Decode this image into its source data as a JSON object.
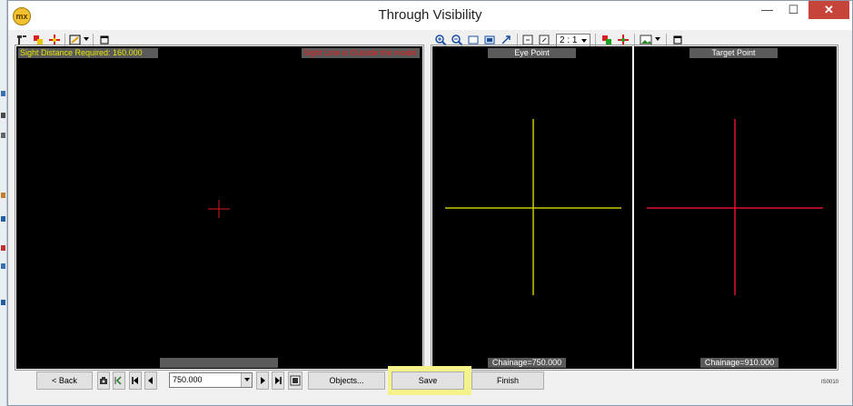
{
  "window": {
    "title": "Through Visibility",
    "app_logo_text": "mx",
    "minimize_glyph": "—",
    "maximize_glyph": "☐",
    "close_glyph": "✕"
  },
  "left_view": {
    "sight_distance_label": "Sight Distance Required: 160.000",
    "sight_line_warning": "Sight Line is Outside the model",
    "bottom_label": ""
  },
  "eye_view": {
    "title": "Eye Point",
    "chainage": "Chainage=750.000"
  },
  "target_view": {
    "title": "Target Point",
    "chainage": "Chainage=910.000"
  },
  "right_toolbar": {
    "zoom_ratio": "2 : 1"
  },
  "bottom_bar": {
    "back_label": "< Back",
    "chainage_value": "750.000",
    "objects_label": "Objects...",
    "save_label": "Save",
    "finish_label": "Finish",
    "status_code": "IS0010"
  },
  "colors": {
    "eye_cross": "#c8c800",
    "target_cross": "#e0102a",
    "left_marker": "#d81c1c",
    "highlight": "#f4f28a",
    "close_button": "#c7443a"
  }
}
